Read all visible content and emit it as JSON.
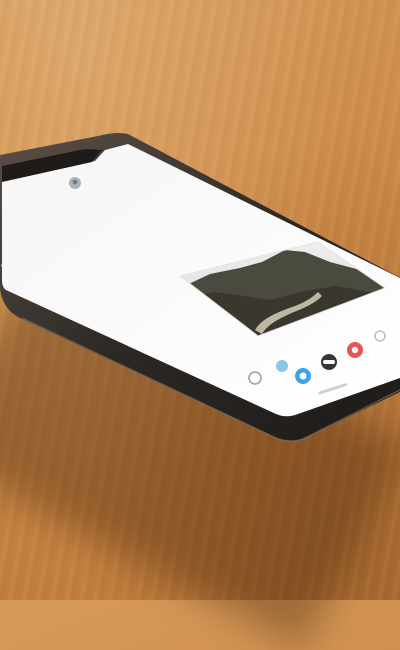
{
  "scene": {
    "surface": "wooden-table",
    "device": "smartphone",
    "device_state": "screen-on",
    "colors": {
      "table": "#cf8d4b",
      "phone_frame": "#2f2b27",
      "screen": "#ffffff",
      "message_image_sky": "#e7e8ea",
      "message_image_mountain": "#4b4a3f"
    }
  },
  "screen": {
    "conversation": {
      "attachment": "landscape-photo"
    },
    "app_bar": {
      "items": [
        "camera-icon",
        "app-store-icon",
        "photos-icon",
        "memoji-icon",
        "heart-icon",
        "more-icon"
      ]
    }
  }
}
